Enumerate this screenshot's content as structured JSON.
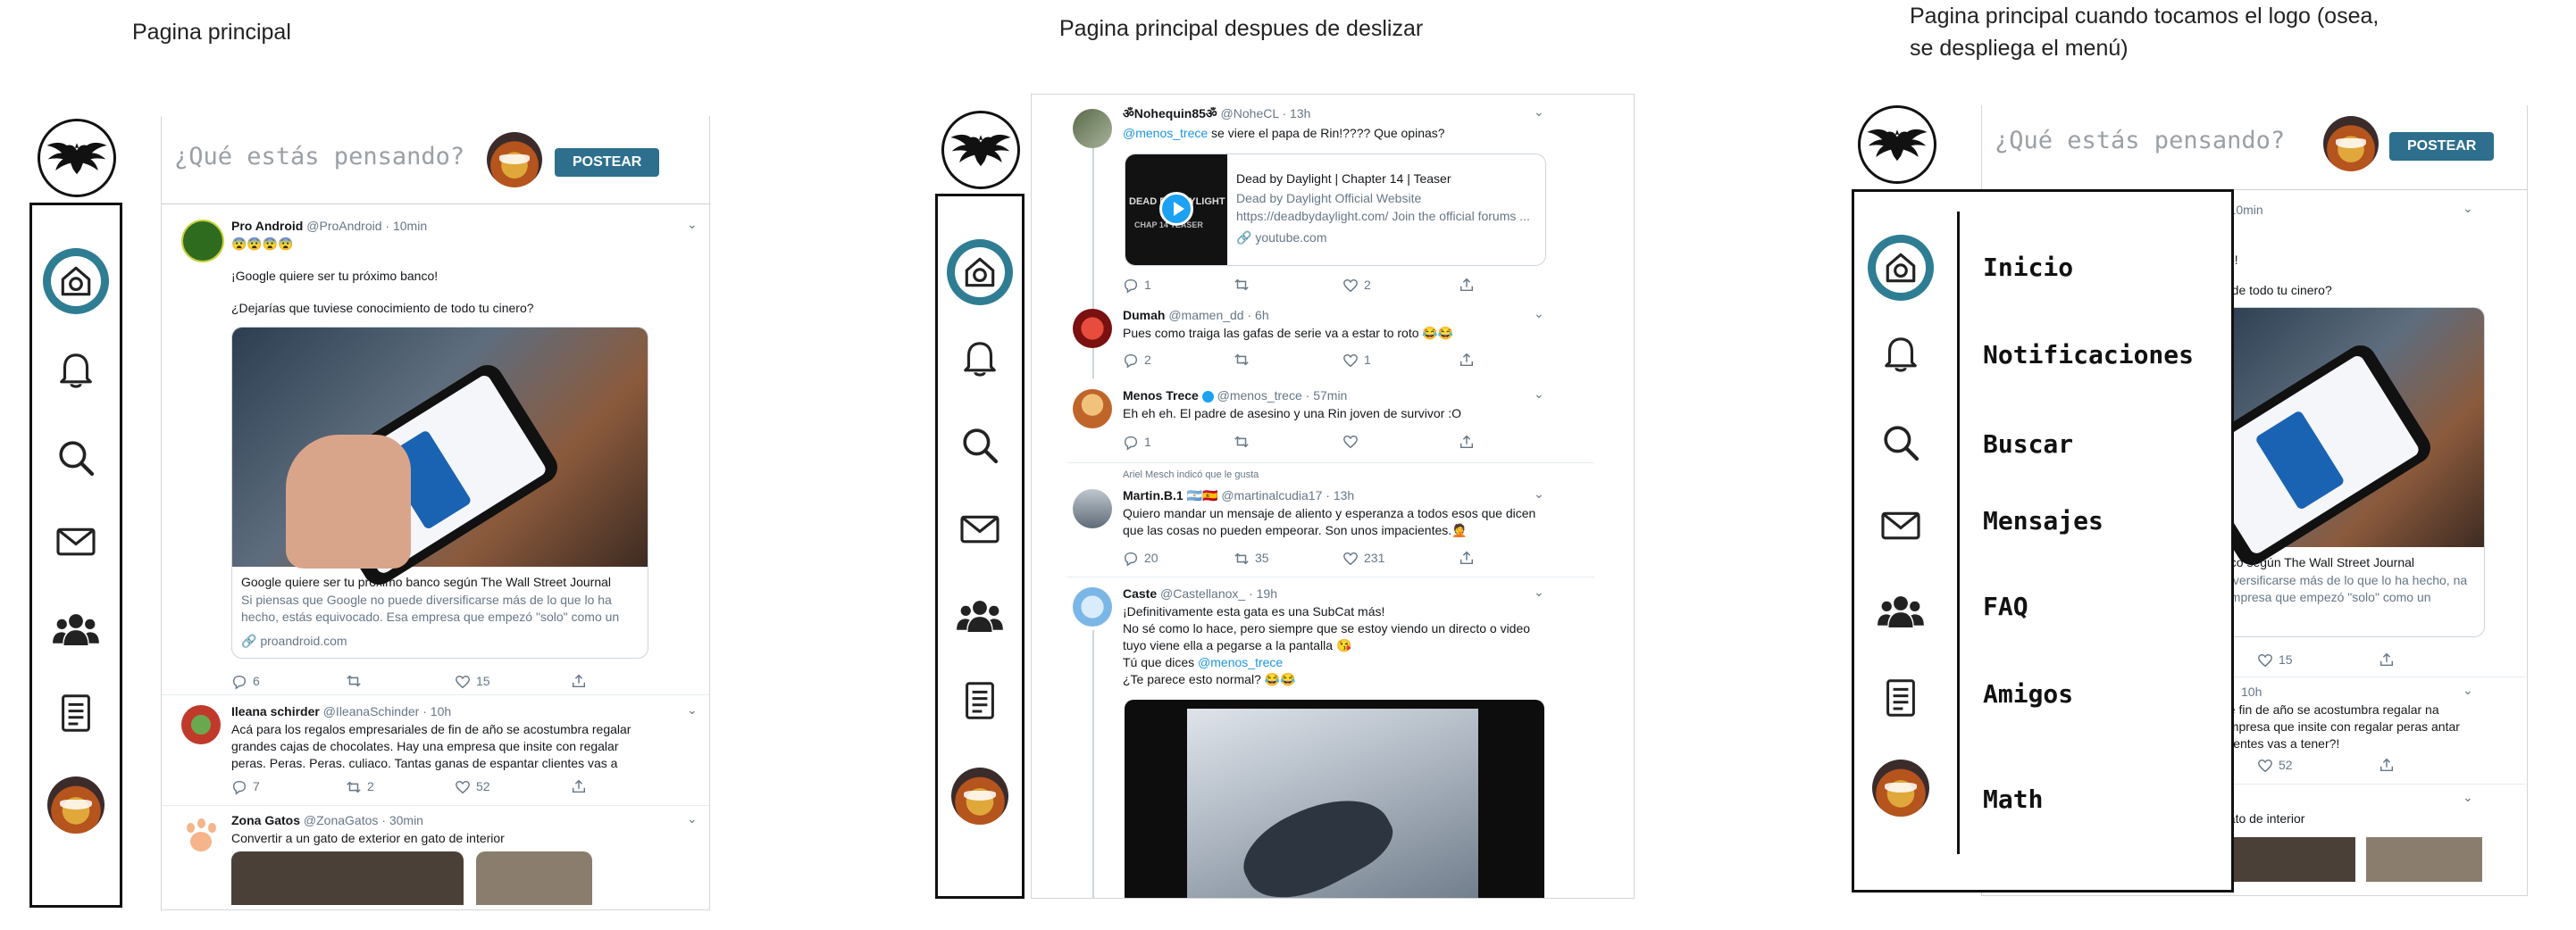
{
  "captions": {
    "screen1": "Pagina principal",
    "screen2": "Pagina principal despues de deslizar",
    "screen3": "Pagina principal cuando tocamos el logo (osea, se despliega el menú)"
  },
  "nav_icons": [
    "eagle-logo",
    "home-icon",
    "bell-icon",
    "search-icon",
    "mail-icon",
    "group-icon",
    "document-icon",
    "profile-avatar"
  ],
  "compose": {
    "placeholder": "¿Qué estás pensando?",
    "post_label": "POSTEAR"
  },
  "screen1": {
    "tweet1": {
      "name": "Pro Android",
      "handle": "@ProAndroid",
      "time": "· 10min",
      "emojis": "😨😨😨😨",
      "line1": "¡Google quiere ser tu próximo banco!",
      "line2": "¿Dejarías que tuviese conocimiento de todo tu cinero?",
      "card_title": "Google quiere ser tu próximo banco según The Wall Street Journal",
      "card_desc": "Si piensas que Google no puede diversificarse más de lo que lo ha hecho, estás equivocado. Esa empresa que empezó \"solo\" como un navegador ...",
      "card_domain": "🔗 proandroid.com",
      "replies": "6",
      "likes": "15"
    },
    "tweet2": {
      "name": "Ileana schirder",
      "handle": "@IleanaSchinder",
      "time": "· 10h",
      "text": "Acá para los regalos empresariales de fin de año se acostumbra regalar grandes cajas de chocolates. Hay una empresa que insite con regalar peras. Peras. Peras. culiaco. Tantas ganas de espantar clientes vas a tener?!",
      "replies": "7",
      "retweets": "2",
      "likes": "52"
    },
    "tweet3": {
      "name": "Zona Gatos",
      "handle": "@ZonaGatos",
      "time": "· 30min",
      "text": "Convertir a un gato de exterior en gato de interior"
    }
  },
  "screen2": {
    "tweet1": {
      "name": "ॐNohequin85ॐ",
      "handle": "@NoheCL",
      "time": "· 13h",
      "mention": "@menos_trece",
      "text": " se viere el papa de Rin!???? Que opinas?",
      "card_title": "Dead by Daylight | Chapter 14 | Teaser",
      "card_sub": "Dead by Daylight Official Website",
      "card_desc": "https://deadbydaylight.com/ Join the official forums ...",
      "card_domain": "🔗 youtube.com",
      "thumb_text": "DEAD BY DAYLIGHT",
      "thumb_sub": "CHAP 14 TEASER",
      "replies": "1",
      "likes": "2"
    },
    "tweet2": {
      "name": "Dumah",
      "handle": "@mamen_dd",
      "time": "· 6h",
      "text": "Pues como traiga las gafas de serie va a estar to roto 😂😂",
      "replies": "2",
      "likes": "1"
    },
    "tweet3": {
      "name": "Menos Trece",
      "handle": "@menos_trece",
      "time": "· 57min",
      "text": "Eh eh eh. El padre de asesino y una Rin joven de survivor :O",
      "replies": "1"
    },
    "liked_note": "Ariel Mesch indicó que le gusta",
    "tweet4": {
      "name": "Martin.B.1 🇦🇷🇪🇸",
      "handle": "@martinalcudia17",
      "time": "· 13h",
      "text": "Quiero mandar un mensaje de aliento y esperanza a todos esos que dicen que las cosas no pueden empeorar. Son unos impacientes.🤦",
      "replies": "20",
      "retweets": "35",
      "likes": "231"
    },
    "tweet5": {
      "name": "Caste",
      "handle": "@Castellanox_",
      "time": "· 19h",
      "line1": "¡Definitivamente esta gata es una SubCat más!",
      "line2": "No sé como lo hace, pero siempre que se estoy viendo un directo o video tuyo viene ella a pegarse a la pantalla 😘",
      "line3_pre": "Tú que dices ",
      "line3_mention": "@menos_trece",
      "line4": "¿Te parece esto normal? 😂😂"
    }
  },
  "screen3": {
    "menu_items": [
      "Inicio",
      "Notificaciones",
      "Buscar",
      "Mensajes",
      "FAQ",
      "Amigos",
      "Math"
    ],
    "bg": {
      "time": "· 10min",
      "excl": "co!",
      "line": "o de todo tu cinero?",
      "card_title": "nco según The Wall Street Journal",
      "card_desc": "diversificarse más de lo que lo ha hecho, na empresa que empezó \"solo\" como un navegador ...",
      "likes": "15",
      "time2": "10h",
      "text2": "de fin de año se acostumbra regalar na empresa que insite con regalar peras antar clientes vas a tener?!",
      "likes2": "52",
      "text3": "gato de interior"
    }
  }
}
